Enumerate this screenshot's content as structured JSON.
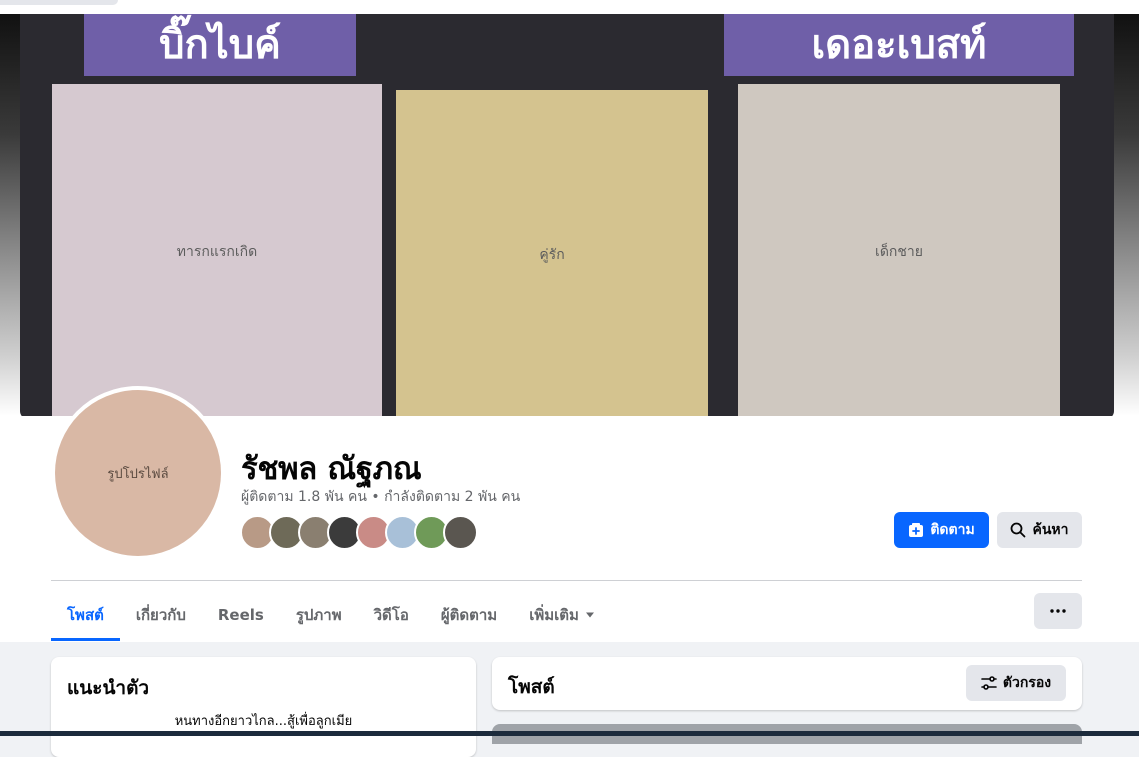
{
  "profile": {
    "name": "รัชพล ณัฐภณ",
    "stats": "ผู้ติดตาม 1.8 พัน คน • กำลังติดตาม 2 พัน คน",
    "cover_label_left": "บิ๊กไบค์",
    "cover_label_right": "เดอะเบสท์",
    "cover_photos": [
      "ทารกแรกเกิด",
      "คู่รัก",
      "เด็กชาย"
    ],
    "avatar_alt": "รูปโปรไฟล์",
    "friend_count_shown": 8
  },
  "actions": {
    "follow_label": "ติดตาม",
    "search_label": "ค้นหา"
  },
  "tabs": [
    {
      "label": "โพสต์",
      "active": true
    },
    {
      "label": "เกี่ยวกับ",
      "active": false
    },
    {
      "label": "Reels",
      "active": false
    },
    {
      "label": "รูปภาพ",
      "active": false
    },
    {
      "label": "วิดีโอ",
      "active": false
    },
    {
      "label": "ผู้ติดตาม",
      "active": false
    },
    {
      "label": "เพิ่มเติม",
      "active": false
    }
  ],
  "intro": {
    "title": "แนะนำตัว",
    "bio": "หนทางอีกยาวไกล...สู้เพื่อลูกเมีย"
  },
  "posts": {
    "title": "โพสต์",
    "filter_label": "ตัวกรอง"
  },
  "colors": {
    "accent": "#0866ff",
    "button_gray": "#e4e6eb",
    "page_bg": "#f0f2f5"
  }
}
